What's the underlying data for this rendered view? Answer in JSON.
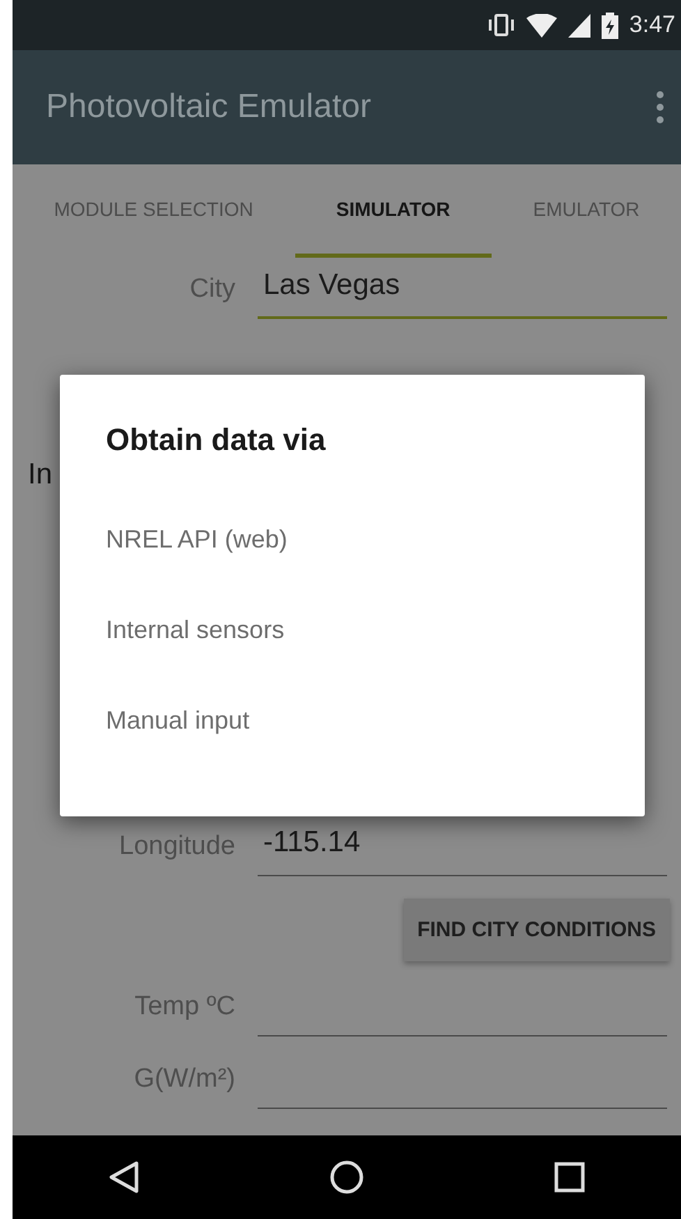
{
  "status_bar": {
    "time": "3:47"
  },
  "app_bar": {
    "title": "Photovoltaic Emulator"
  },
  "tabs": [
    {
      "label": "MODULE SELECTION",
      "selected": false
    },
    {
      "label": "SIMULATOR",
      "selected": true
    },
    {
      "label": "EMULATOR",
      "selected": false
    }
  ],
  "form": {
    "city": {
      "label": "City",
      "value": "Las Vegas"
    },
    "partial_label": "In",
    "longitude": {
      "label": "Longitude",
      "value": "-115.14"
    },
    "find_button": "FIND CITY CONDITIONS",
    "temp": {
      "label": "Temp ºC"
    },
    "irradiance": {
      "label": "G(W/m²)"
    }
  },
  "dialog": {
    "title": "Obtain data via",
    "options": [
      "NREL API (web)",
      "Internal sensors",
      "Manual input"
    ]
  }
}
